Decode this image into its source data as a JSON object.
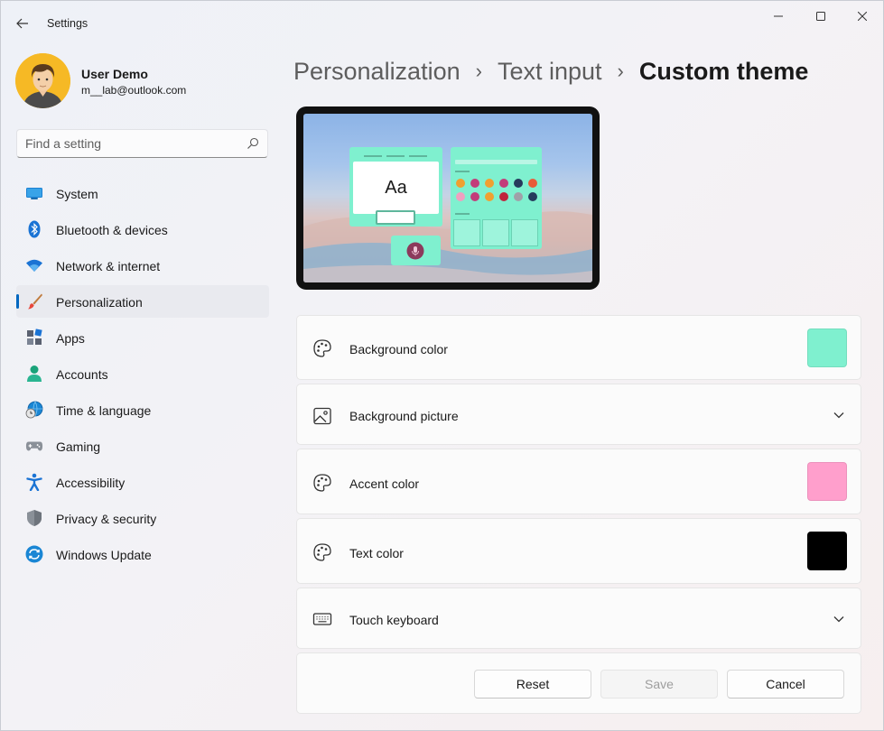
{
  "window": {
    "title": "Settings"
  },
  "profile": {
    "name": "User Demo",
    "email": "m__lab@outlook.com"
  },
  "search": {
    "placeholder": "Find a setting"
  },
  "sidebar": {
    "items": [
      {
        "label": "System",
        "icon": "system-icon"
      },
      {
        "label": "Bluetooth & devices",
        "icon": "bluetooth-icon"
      },
      {
        "label": "Network & internet",
        "icon": "wifi-icon"
      },
      {
        "label": "Personalization",
        "icon": "brush-icon",
        "selected": true
      },
      {
        "label": "Apps",
        "icon": "apps-icon"
      },
      {
        "label": "Accounts",
        "icon": "accounts-icon"
      },
      {
        "label": "Time & language",
        "icon": "globe-clock-icon"
      },
      {
        "label": "Gaming",
        "icon": "gamepad-icon"
      },
      {
        "label": "Accessibility",
        "icon": "accessibility-icon"
      },
      {
        "label": "Privacy & security",
        "icon": "shield-icon"
      },
      {
        "label": "Windows Update",
        "icon": "update-icon"
      }
    ]
  },
  "breadcrumb": {
    "items": [
      "Personalization",
      "Text input",
      "Custom theme"
    ],
    "separator": "›"
  },
  "preview": {
    "sample_text": "Aa",
    "colors": {
      "panel": "#7ff0cf",
      "dots": [
        "#f0a030",
        "#c23c7a",
        "#f0a030",
        "#c23c7a",
        "#263a5c",
        "#e85c3a",
        "#f0a0c0",
        "#c23c7a",
        "#f0a030",
        "#c0243c",
        "#a0a0a8",
        "#263a5c"
      ]
    }
  },
  "settings": {
    "background_color": {
      "label": "Background color",
      "icon": "palette-icon",
      "color": "#7ff0cf"
    },
    "background_picture": {
      "label": "Background picture",
      "icon": "picture-icon"
    },
    "accent_color": {
      "label": "Accent color",
      "icon": "palette-icon",
      "color": "#ff9fcc"
    },
    "text_color": {
      "label": "Text color",
      "icon": "palette-icon",
      "color": "#000000"
    },
    "touch_keyboard": {
      "label": "Touch keyboard",
      "icon": "keyboard-icon"
    }
  },
  "buttons": {
    "reset": "Reset",
    "save": "Save",
    "cancel": "Cancel"
  }
}
